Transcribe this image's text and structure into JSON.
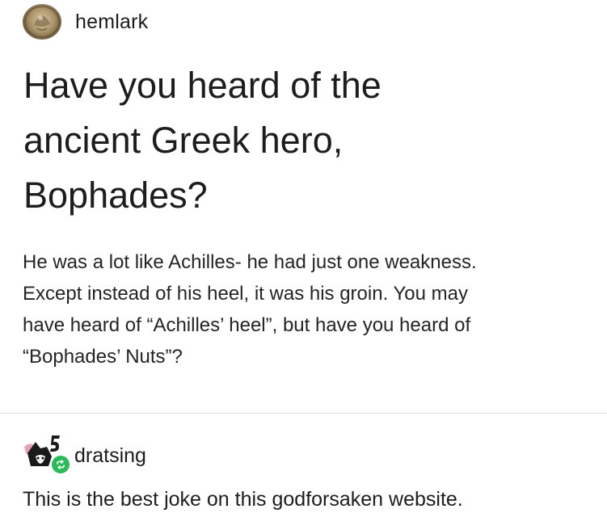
{
  "post": {
    "author": "hemlark",
    "avatar_icon": "coin-avatar-icon",
    "title_lines": [
      "Have you heard of the",
      "ancient Greek hero,",
      "Bophades?"
    ],
    "body_lines": [
      "He was a lot like Achilles- he had just one weakness.",
      "Except instead of his heel, it was his groin. You may",
      "have heard of “Achilles’ heel”, but have you heard of",
      "“Bophades’ Nuts”?"
    ]
  },
  "reblog": {
    "author": "dratsing",
    "avatar_icon": "cartoon-avatar-icon",
    "badge_icon": "reblog-icon",
    "badge_color": "#2db85a",
    "text": "This is the best joke on this godforsaken website."
  }
}
